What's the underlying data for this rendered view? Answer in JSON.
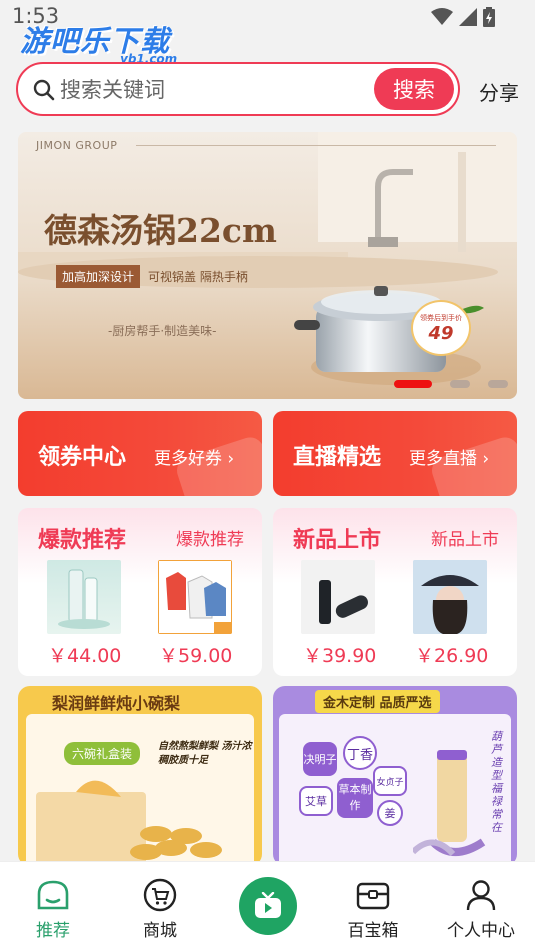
{
  "status": {
    "time": "1:53"
  },
  "watermark": {
    "main": "游吧乐下载",
    "sub": "yb1.com"
  },
  "search": {
    "placeholder": "搜索关键词",
    "button_label": "搜索",
    "share_label": "分享"
  },
  "banner": {
    "brand": "JIMON GROUP",
    "title": "德森汤锅22cm",
    "tag_primary": "加高加深设计",
    "tag_secondary": "可视锅盖 隔热手柄",
    "slogan": "-厨房帮手·制造美味-",
    "badge_label": "领券后到手价",
    "badge_price": "49",
    "pages": 3,
    "active_page": 1
  },
  "promos": [
    {
      "title": "领券中心",
      "link": "更多好券",
      "arrow": "›"
    },
    {
      "title": "直播精选",
      "link": "更多直播",
      "arrow": "›"
    }
  ],
  "sections": [
    {
      "title": "爆款推荐",
      "subtitle": "爆款推荐",
      "items": [
        {
          "price": "￥44.00"
        },
        {
          "price": "￥59.00"
        }
      ]
    },
    {
      "title": "新品上市",
      "subtitle": "新品上市",
      "items": [
        {
          "price": "￥39.90"
        },
        {
          "price": "￥26.90"
        }
      ]
    }
  ],
  "features": [
    {
      "title": "梨润鲜鲜炖小碗梨",
      "tag": "六碗礼盒装",
      "desc": "自然熬梨鲜梨 汤汁浓稠胶质十足"
    },
    {
      "title": "金木定制 品质严选",
      "herbs": [
        "决明子",
        "丁香",
        "女贞子",
        "艾草",
        "草本制作",
        "姜"
      ],
      "side": "葫芦造型 福禄常在"
    }
  ],
  "tabs": [
    {
      "label": "推荐",
      "icon": "home-icon",
      "active": true
    },
    {
      "label": "商城",
      "icon": "cart-icon",
      "active": false
    },
    {
      "label": "",
      "icon": "tv-icon",
      "active": false
    },
    {
      "label": "百宝箱",
      "icon": "treasure-box-icon",
      "active": false
    },
    {
      "label": "个人中心",
      "icon": "person-icon",
      "active": false
    }
  ],
  "colors": {
    "accent": "#ef3b55",
    "promo": "#f33d2e",
    "tab_active": "#2aa06c",
    "tv_button": "#1fa463"
  }
}
